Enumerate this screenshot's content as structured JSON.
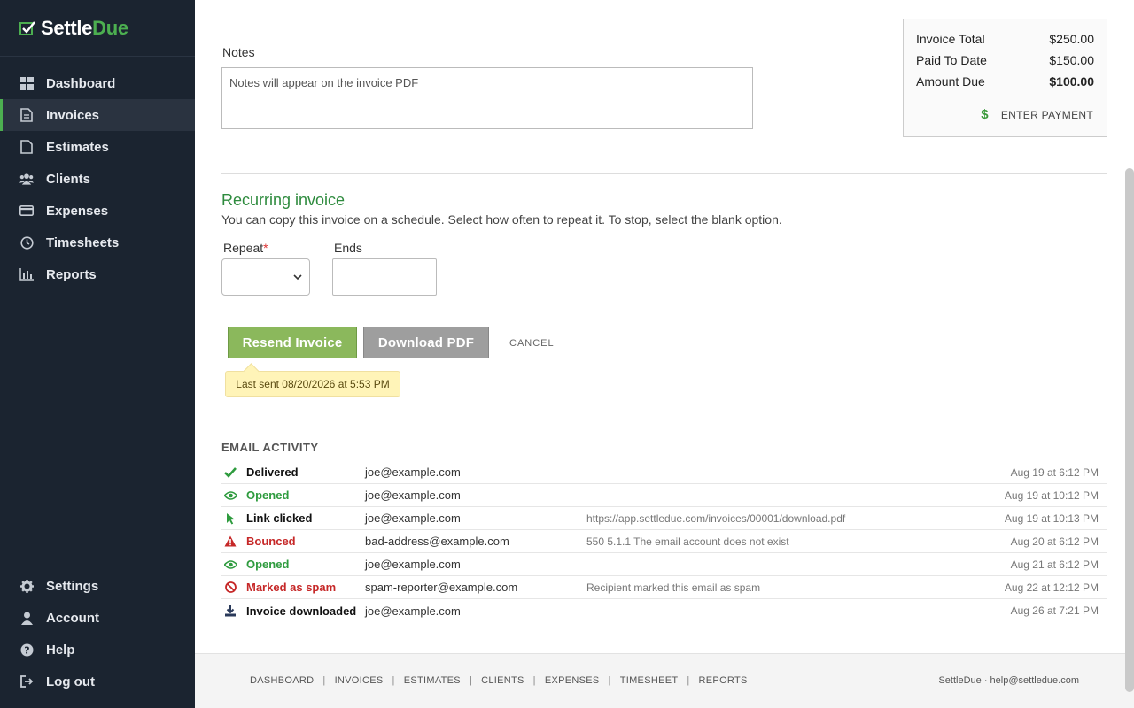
{
  "brand": {
    "name_main": "Settle",
    "name_accent": "Due"
  },
  "sidebar": {
    "items": [
      {
        "label": "Dashboard",
        "icon": "dashboard-icon"
      },
      {
        "label": "Invoices",
        "icon": "invoice-icon",
        "active": true
      },
      {
        "label": "Estimates",
        "icon": "document-icon"
      },
      {
        "label": "Clients",
        "icon": "users-icon"
      },
      {
        "label": "Expenses",
        "icon": "credit-card-icon"
      },
      {
        "label": "Timesheets",
        "icon": "clock-icon"
      },
      {
        "label": "Reports",
        "icon": "bar-chart-icon"
      }
    ],
    "bottom_items": [
      {
        "label": "Settings",
        "icon": "gear-icon"
      },
      {
        "label": "Account",
        "icon": "user-icon"
      },
      {
        "label": "Help",
        "icon": "help-icon"
      },
      {
        "label": "Log out",
        "icon": "logout-icon"
      }
    ]
  },
  "notes": {
    "label": "Notes",
    "placeholder": "Notes will appear on the invoice PDF"
  },
  "summary": {
    "invoice_total_label": "Invoice Total",
    "invoice_total": "$250.00",
    "paid_label": "Paid To Date",
    "paid": "$150.00",
    "due_label": "Amount Due",
    "due": "$100.00",
    "enter_payment": "ENTER PAYMENT"
  },
  "recurring": {
    "title": "Recurring invoice",
    "description": "You can copy this invoice on a schedule. Select how often to repeat it. To stop, select the blank option.",
    "repeat_label": "Repeat",
    "required_mark": "*",
    "ends_label": "Ends"
  },
  "actions": {
    "resend": "Resend Invoice",
    "download": "Download PDF",
    "cancel": "CANCEL",
    "last_sent": "Last sent 08/20/2026 at 5:53 PM"
  },
  "activity": {
    "title": "EMAIL ACTIVITY",
    "rows": [
      {
        "status": "Delivered",
        "email": "joe@example.com",
        "detail": "",
        "time": "Aug 19 at 6:12 PM"
      },
      {
        "status": "Opened",
        "email": "joe@example.com",
        "detail": "",
        "time": "Aug 19 at 10:12 PM"
      },
      {
        "status": "Link clicked",
        "email": "joe@example.com",
        "detail": "https://app.settledue.com/invoices/00001/download.pdf",
        "time": "Aug 19 at 10:13 PM"
      },
      {
        "status": "Bounced",
        "email": "bad-address@example.com",
        "detail": "550 5.1.1 The email account does not exist",
        "time": "Aug 20 at 6:12 PM"
      },
      {
        "status": "Opened",
        "email": "joe@example.com",
        "detail": "",
        "time": "Aug 21 at 6:12 PM"
      },
      {
        "status": "Marked as spam",
        "email": "spam-reporter@example.com",
        "detail": "Recipient marked this email as spam",
        "time": "Aug 22 at 12:12 PM"
      },
      {
        "status": "Invoice downloaded",
        "email": "joe@example.com",
        "detail": "",
        "time": "Aug 26 at 7:21 PM"
      }
    ]
  },
  "footer": {
    "links": [
      "DASHBOARD",
      "INVOICES",
      "ESTIMATES",
      "CLIENTS",
      "EXPENSES",
      "TIMESHEET",
      "REPORTS"
    ],
    "separator": "|",
    "right_text": "SettleDue · help@settledue.com"
  },
  "colors": {
    "accent": "#4caf50",
    "sidebar_bg": "#1b2430",
    "green_text": "#2e9b3e",
    "red_text": "#c62828",
    "resend_bg": "#8bb85c"
  }
}
